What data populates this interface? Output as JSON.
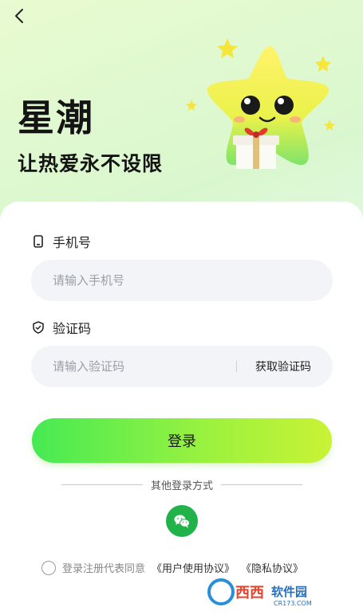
{
  "nav": {
    "back_icon": "chevron-left-icon"
  },
  "hero": {
    "title": "星潮",
    "subtitle": "让热爱永不设限"
  },
  "form": {
    "phone": {
      "label": "手机号",
      "placeholder": "请输入手机号",
      "icon": "phone-icon"
    },
    "code": {
      "label": "验证码",
      "placeholder": "请输入验证码",
      "icon": "shield-check-icon",
      "get_code_label": "获取验证码"
    },
    "login_label": "登录",
    "other_methods": "其他登录方式",
    "agreement": {
      "prefix": "登录注册代表同意",
      "user_agreement": "《用户使用协议》",
      "privacy": "《隐私协议》"
    }
  },
  "watermark": {
    "brand": "西西",
    "text": "软件园",
    "url": "CR173.COM"
  },
  "colors": {
    "accent_start": "#46ea54",
    "accent_end": "#c9f236",
    "wechat": "#21b24a"
  }
}
